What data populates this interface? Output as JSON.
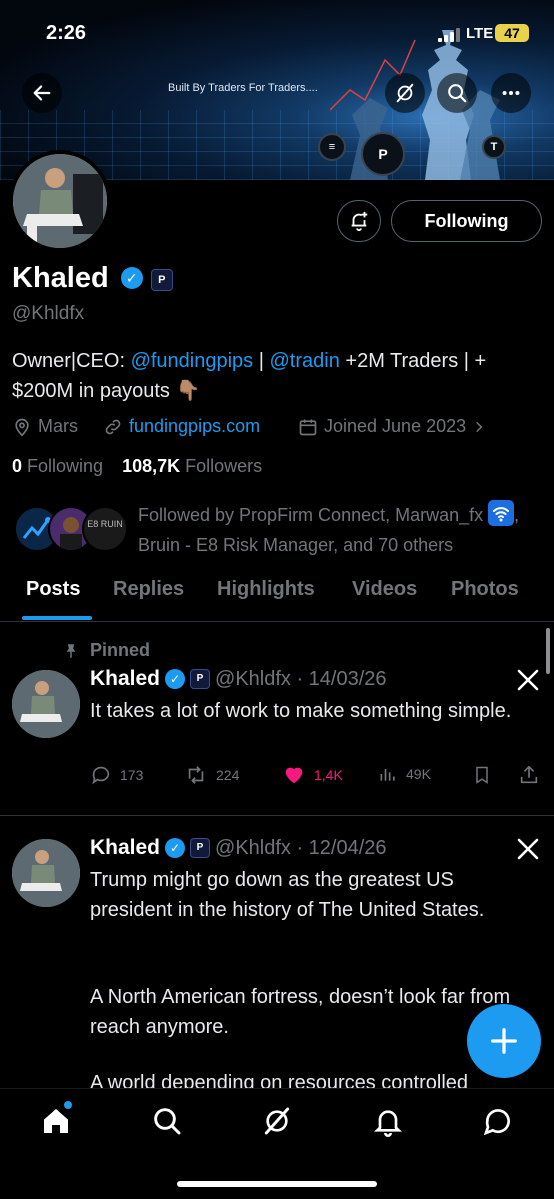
{
  "status_bar": {
    "time": "2:26",
    "network": "LTE",
    "battery": "47"
  },
  "banner": {
    "tagline": "Built By Traders For Traders...."
  },
  "profile": {
    "name": "Khaled",
    "affiliate_badge": "P",
    "handle": "@Khldfx",
    "follow_button": "Following",
    "bio": {
      "prefix": "Owner|CEO: ",
      "mention1": "@fundingpips",
      "sep": " | ",
      "mention2": "@tradin",
      "rest": " +2M Traders | + $200M in payouts 👇🏽"
    },
    "location": "Mars",
    "website": "fundingpips.com",
    "joined": "Joined June 2023",
    "following_count": "0",
    "following_label": "Following",
    "followers_count": "108,7K",
    "followers_label": "Followers",
    "followed_by": "Followed by PropFirm Connect, Marwan_fx",
    "followed_by_more": ", Bruin - E8 Risk Manager, and 70 others",
    "followed_avatar_text": "E8 RUIN"
  },
  "tabs": [
    "Posts",
    "Replies",
    "Highlights",
    "Videos",
    "Photos"
  ],
  "posts": [
    {
      "pinned_label": "Pinned",
      "author": "Khaled",
      "handle_date": "@Khldfx · 14/03/26",
      "text": "It takes a lot of work to make something simple.",
      "replies": "173",
      "reposts": "224",
      "likes": "1,4K",
      "views": "49K"
    },
    {
      "author": "Khaled",
      "handle_date": "@Khldfx · 12/04/26",
      "text_p1": "Trump might go down as the greatest US president in the history of The United States.",
      "text_p2": "A North American fortress, doesn’t look far from reach anymore.",
      "text_p3": "A world depending on resources controlled"
    }
  ],
  "colors": {
    "accent": "#1d9bf0",
    "like": "#f91880",
    "muted": "#71767b"
  }
}
